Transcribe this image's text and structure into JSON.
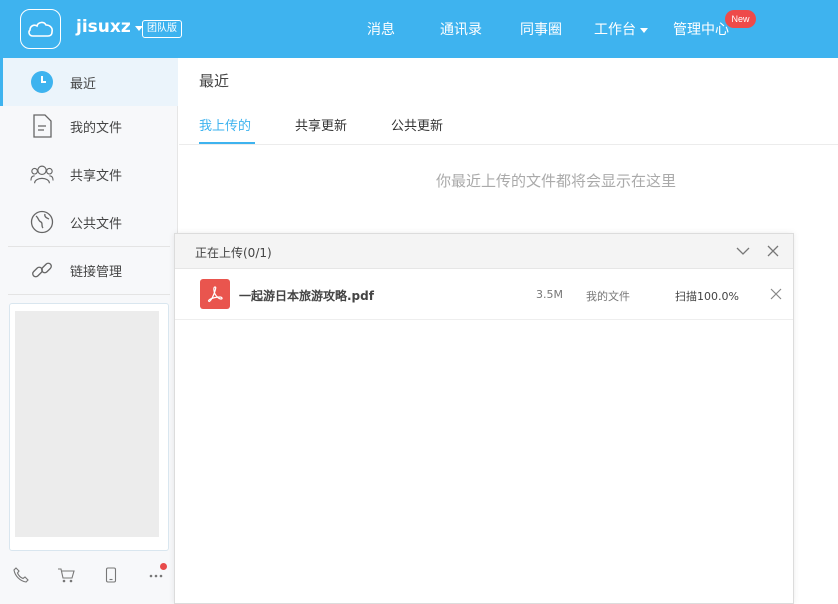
{
  "header": {
    "brand": "jisuxz",
    "edition_badge": "团队版",
    "nav": [
      {
        "label": "消息"
      },
      {
        "label": "通讯录"
      },
      {
        "label": "同事圈"
      },
      {
        "label": "工作台"
      },
      {
        "label": "管理中心"
      }
    ],
    "new_badge": "New"
  },
  "sidebar": {
    "items": [
      {
        "label": "最近",
        "icon": "clock-icon",
        "active": true
      },
      {
        "label": "我的文件",
        "icon": "document-icon"
      },
      {
        "label": "共享文件",
        "icon": "users-icon"
      },
      {
        "label": "公共文件",
        "icon": "globe-icon"
      },
      {
        "label": "链接管理",
        "icon": "link-icon"
      }
    ],
    "tools": [
      "phone-icon",
      "cart-icon",
      "mobile-icon",
      "more-icon"
    ]
  },
  "main": {
    "title": "最近",
    "tabs": [
      {
        "label": "我上传的",
        "active": true
      },
      {
        "label": "共享更新"
      },
      {
        "label": "公共更新"
      }
    ],
    "empty_hint": "你最近上传的文件都将会显示在这里"
  },
  "upload_panel": {
    "title": "正在上传(0/1)",
    "files": [
      {
        "name": "一起游日本旅游攻略.pdf",
        "size": "3.5M",
        "destination": "我的文件",
        "status": "扫描100.0%",
        "icon": "pdf-icon"
      }
    ]
  },
  "colors": {
    "accent": "#3eb3ef",
    "badge_red": "#ee4a4a",
    "pdf_red": "#e9554e"
  }
}
